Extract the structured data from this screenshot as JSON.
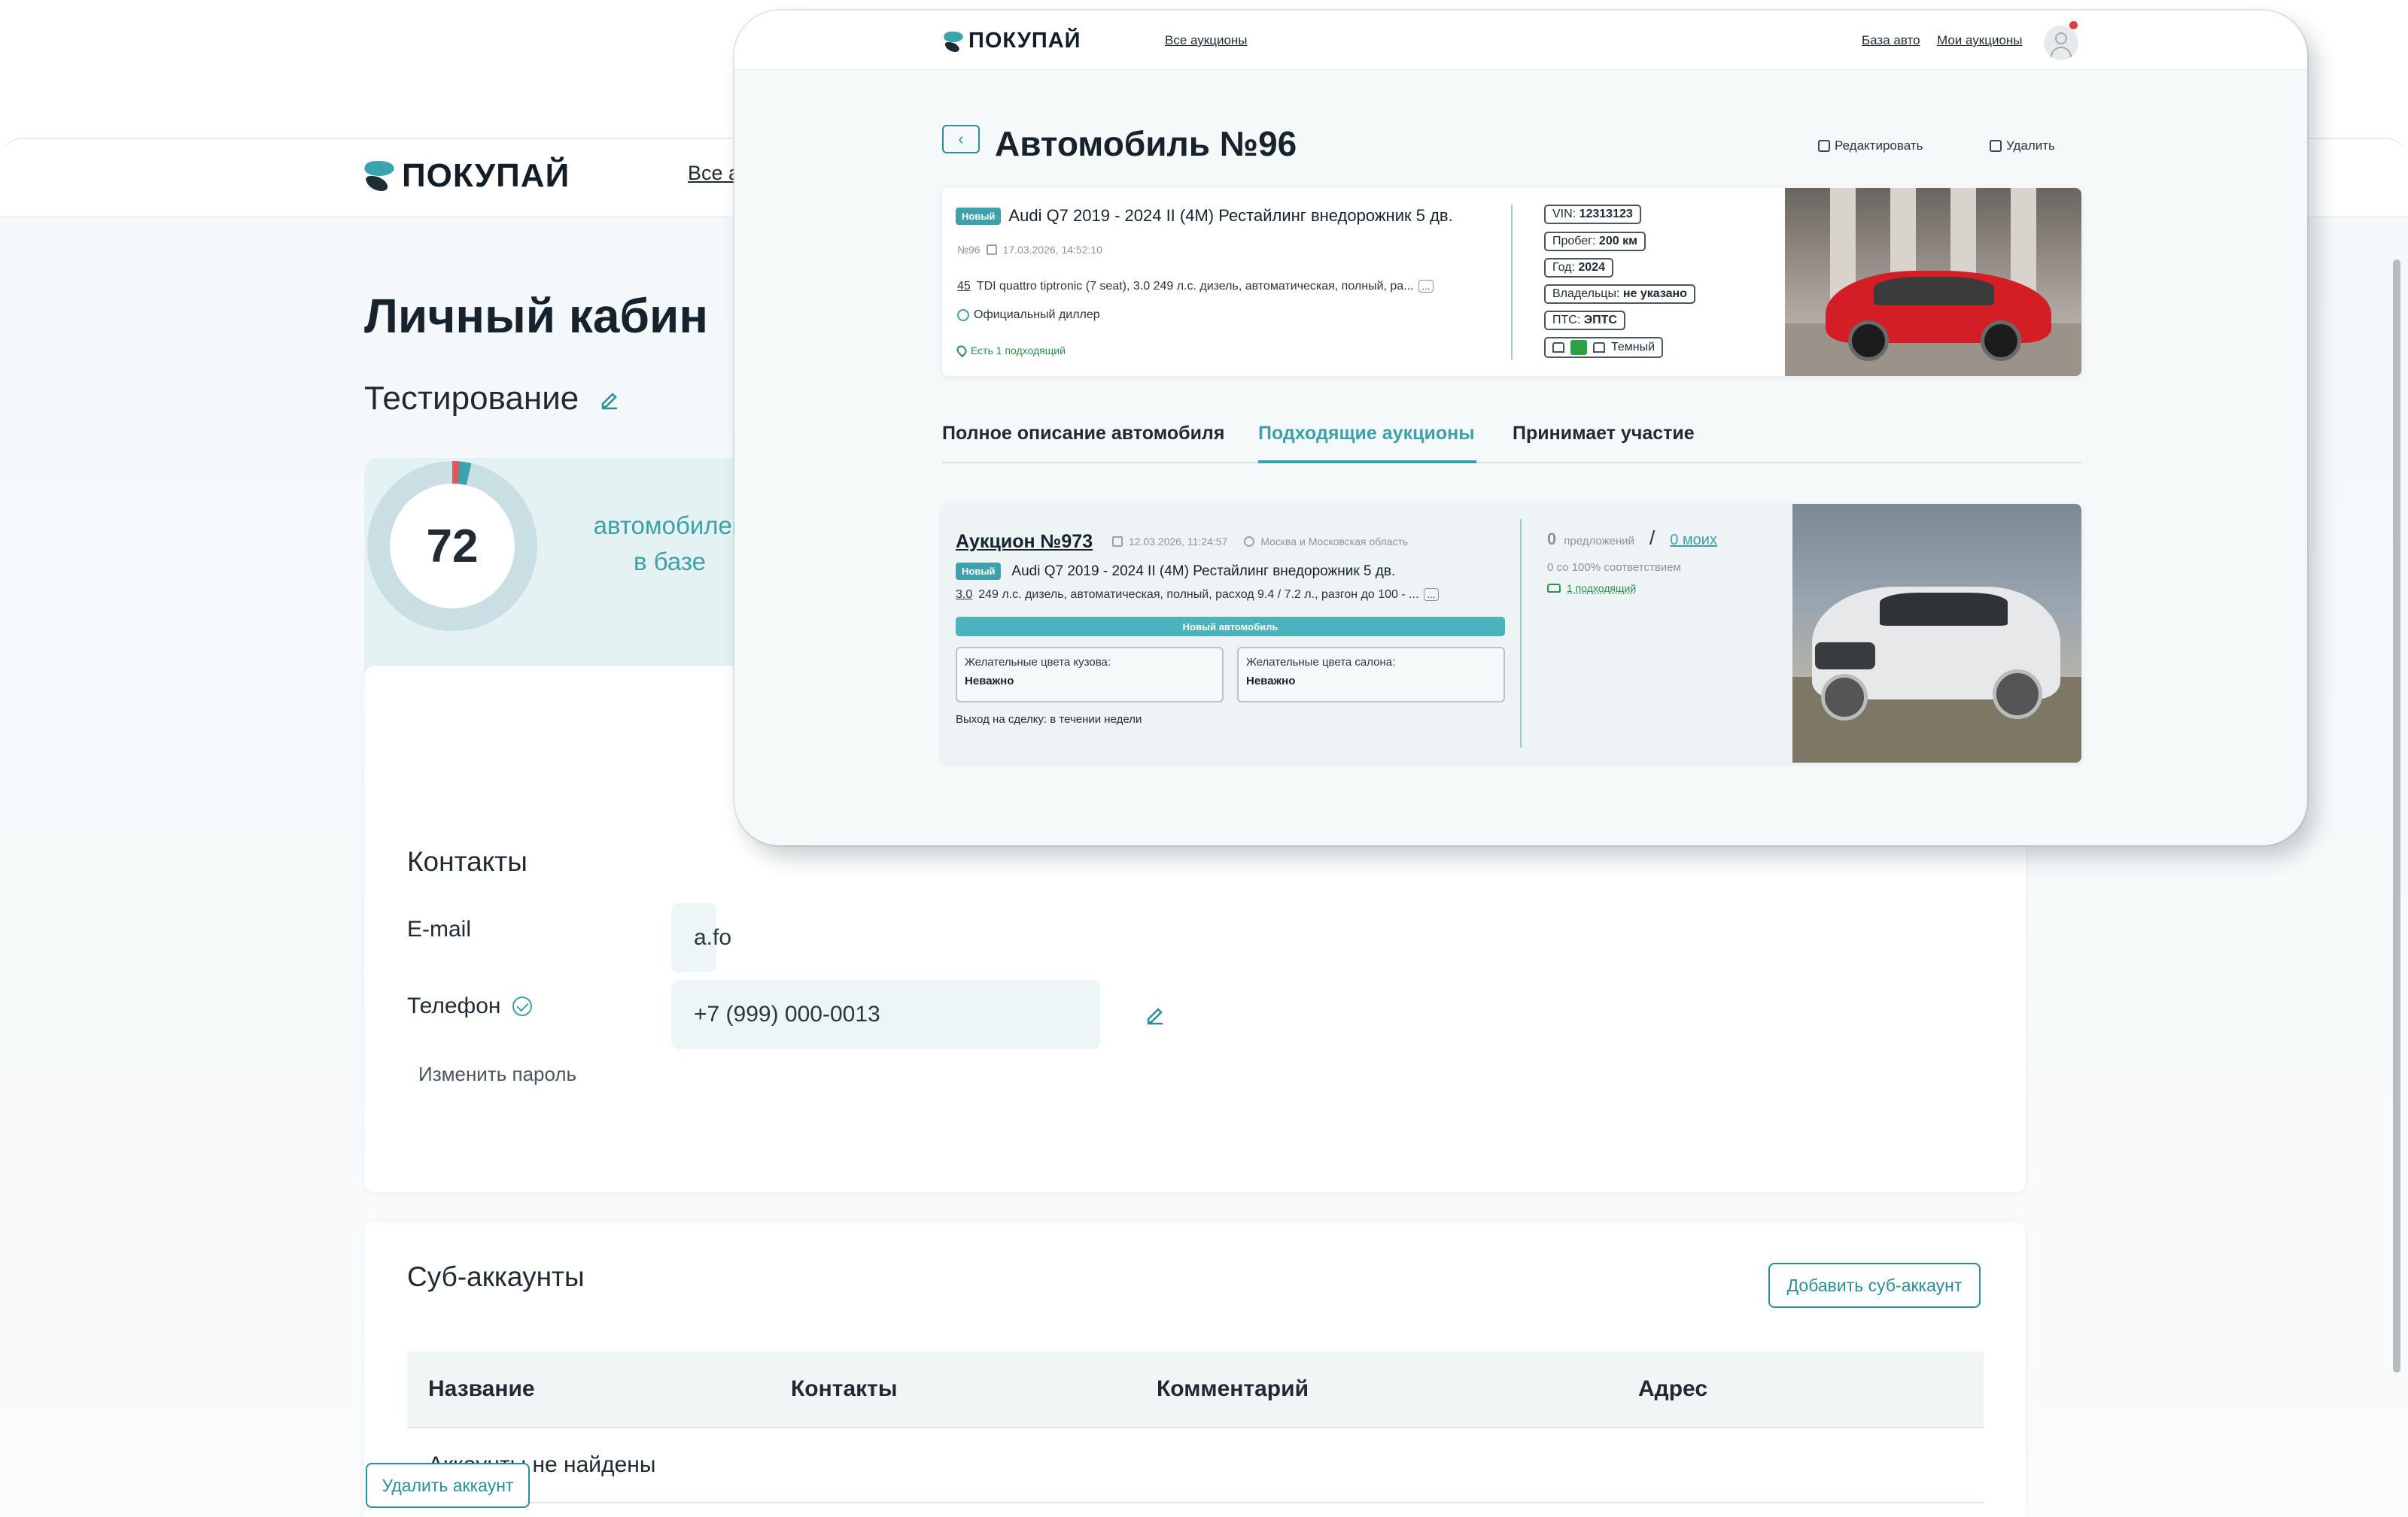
{
  "colors": {
    "accent": "#3ea0aa",
    "accent_dark": "#2a8f99",
    "success": "#2e8f4a",
    "danger": "#e23b3b",
    "chart_track": "#c9dfe4"
  },
  "brand": {
    "name": "ПОКУПАЙ"
  },
  "profile": {
    "nav_link": "Все а",
    "page_title": "Личный кабин",
    "company": "Тестирование",
    "stats": {
      "value": "72",
      "label_line1": "автомобилей",
      "label_line2": "в базе"
    },
    "contacts": {
      "title": "Контакты",
      "email_label": "E-mail",
      "email_value": "a.fo",
      "phone_label": "Телефон",
      "phone_value": "+7 (999) 000-0013",
      "change_password": "Изменить пароль"
    },
    "sub_accounts": {
      "title": "Суб-аккаунты",
      "add_button": "Добавить суб-аккаунт",
      "columns": [
        "Название",
        "Контакты",
        "Комментарий",
        "Адрес"
      ],
      "empty": "Аккаунты не найдены"
    },
    "delete_account": "Удалить аккаунт"
  },
  "car_page": {
    "header": {
      "all_auctions": "Все аукционы",
      "car_base": "База авто",
      "my_auctions": "Мои аукционы"
    },
    "title": "Автомобиль №96",
    "edit": "Редактировать",
    "delete": "Удалить",
    "car": {
      "badge": "Новый",
      "name": "Audi Q7 2019 - 2024 II (4M) Рестайлинг внедорожник 5 дв.",
      "number": "№96",
      "date": "17.03.2026, 14:52:10",
      "spec_code": "45",
      "spec": "TDI quattro tiptronic (7 seat), 3.0 249 л.с. дизель, автоматическая, полный, ра...",
      "more": "...",
      "dealer": "Официальный диллер",
      "match": "Есть 1 подходящий",
      "chips": [
        {
          "label": "VIN:",
          "value": "12313123"
        },
        {
          "label": "Пробег:",
          "value": "200 км"
        },
        {
          "label": "Год:",
          "value": "2024"
        },
        {
          "label": "Владельцы:",
          "value": "не указано"
        },
        {
          "label": "ПТС:",
          "value": "ЭПТС"
        }
      ],
      "interior": "Темный"
    },
    "tabs": [
      "Полное описание автомобиля",
      "Подходящие аукционы",
      "Принимает участие"
    ],
    "active_tab": 1,
    "auction": {
      "title": "Аукцион №973",
      "date": "12.03.2026, 11:24:57",
      "region": "Москва и Московская область",
      "badge": "Новый",
      "model": "Audi Q7 2019 - 2024 II (4M) Рестайлинг внедорожник 5 дв.",
      "spec_code": "3.0",
      "spec": "249 л.с. дизель, автоматическая, полный, расход 9.4 / 7.2 л., разгон до 100 - ...",
      "more": "...",
      "bar": "Новый автомобиль",
      "body_colors_label": "Желательные цвета кузова:",
      "body_colors_value": "Неважно",
      "interior_colors_label": "Желательные цвета салона:",
      "interior_colors_value": "Неважно",
      "exit_deal": "Выход на сделку: в течении недели",
      "offers_count": "0",
      "offers_label": "предложений",
      "slash": "/",
      "mine": "0 моих",
      "match_pct": "0 со 100% соответствием",
      "fit": "1 подходящий"
    }
  }
}
